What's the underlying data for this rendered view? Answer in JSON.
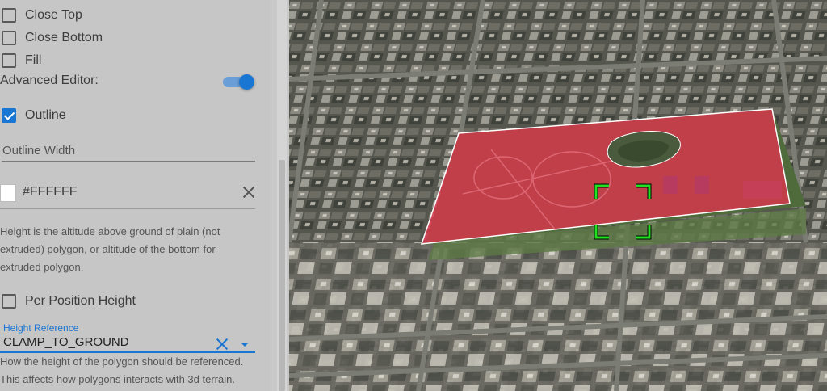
{
  "panel": {
    "close_top": {
      "label": "Close Top",
      "checked": false
    },
    "close_bottom": {
      "label": "Close Bottom",
      "checked": false
    },
    "fill": {
      "label": "Fill",
      "checked": false
    },
    "advanced_editor": {
      "label": "Advanced Editor:",
      "enabled": true
    },
    "outline": {
      "label": "Outline",
      "checked": true
    },
    "outline_width": {
      "placeholder": "Outline Width",
      "value": ""
    },
    "outline_color": {
      "value": "#FFFFFF",
      "swatch": "#ffffff"
    },
    "height_help": "Height is the altitude above ground of plain (not extruded) polygon, or altitude of the bottom for extruded polygon.",
    "per_position_height": {
      "label": "Per Position Height",
      "checked": false
    },
    "height_reference": {
      "label": "Height Reference",
      "value": "CLAMP_TO_GROUND",
      "help": "How the height of the polygon should be referenced. This affects how polygons interacts with 3d terrain."
    }
  },
  "map": {
    "polygon_fill": "#e0334d",
    "polygon_outline": "#ffffff",
    "crosshair_color": "#22e022"
  }
}
